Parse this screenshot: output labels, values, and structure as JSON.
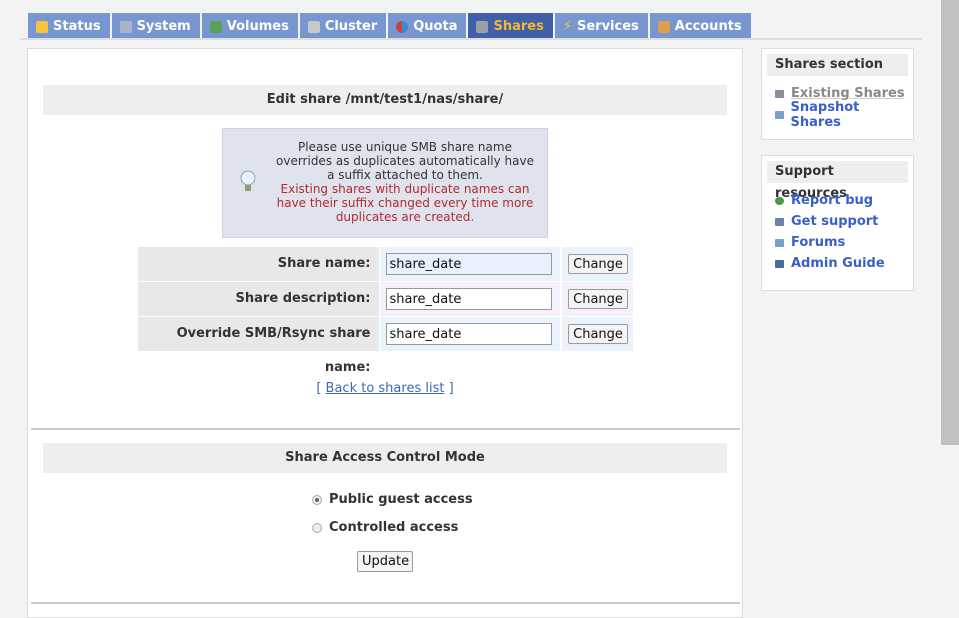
{
  "tabs": [
    {
      "label": "Status",
      "icon": "sun-cloud-icon",
      "color": "#f5c542"
    },
    {
      "label": "System",
      "icon": "computer-icon",
      "color": "#aab4c8"
    },
    {
      "label": "Volumes",
      "icon": "disk-icon",
      "color": "#5aa05a"
    },
    {
      "label": "Cluster",
      "icon": "servers-icon",
      "color": "#c8c8c8"
    },
    {
      "label": "Quota",
      "icon": "pie-icon",
      "color": "#d04040"
    },
    {
      "label": "Shares",
      "icon": "share-drive-icon",
      "color": "#9aa0a8",
      "active": true
    },
    {
      "label": "Services",
      "icon": "lightning-icon",
      "color": "#f5c542"
    },
    {
      "label": "Accounts",
      "icon": "users-icon",
      "color": "#d9a050"
    }
  ],
  "edit": {
    "title": "Edit share /mnt/test1/nas/share/",
    "info_normal": "Please use unique SMB share name overrides as duplicates automatically have a suffix attached to them.",
    "info_warning": "Existing shares with duplicate names can have their suffix changed every time more duplicates are created.",
    "rows": [
      {
        "label": "Share name:",
        "value": "share_date",
        "button": "Change"
      },
      {
        "label": "Share description:",
        "value": "share_date",
        "button": "Change"
      },
      {
        "label": "Override SMB/Rsync share name:",
        "value": "share_date",
        "button": "Change"
      }
    ],
    "back_open": "[",
    "back_link": "Back to shares list",
    "back_close": "]"
  },
  "access": {
    "title": "Share Access Control Mode",
    "options": [
      {
        "label": "Public guest access",
        "selected": true
      },
      {
        "label": "Controlled access",
        "selected": false
      }
    ],
    "update": "Update"
  },
  "sidebar": {
    "shares_title": "Shares section",
    "shares_items": [
      {
        "label": "Existing Shares",
        "icon": "shares-icon"
      },
      {
        "label": "Snapshot Shares",
        "icon": "snapshot-icon"
      }
    ],
    "support_title": "Support resources",
    "support_items": [
      {
        "label": "Report bug",
        "icon": "bug-icon"
      },
      {
        "label": "Get support",
        "icon": "support-icon"
      },
      {
        "label": "Forums",
        "icon": "forums-icon"
      },
      {
        "label": "Admin Guide",
        "icon": "book-icon"
      }
    ]
  }
}
